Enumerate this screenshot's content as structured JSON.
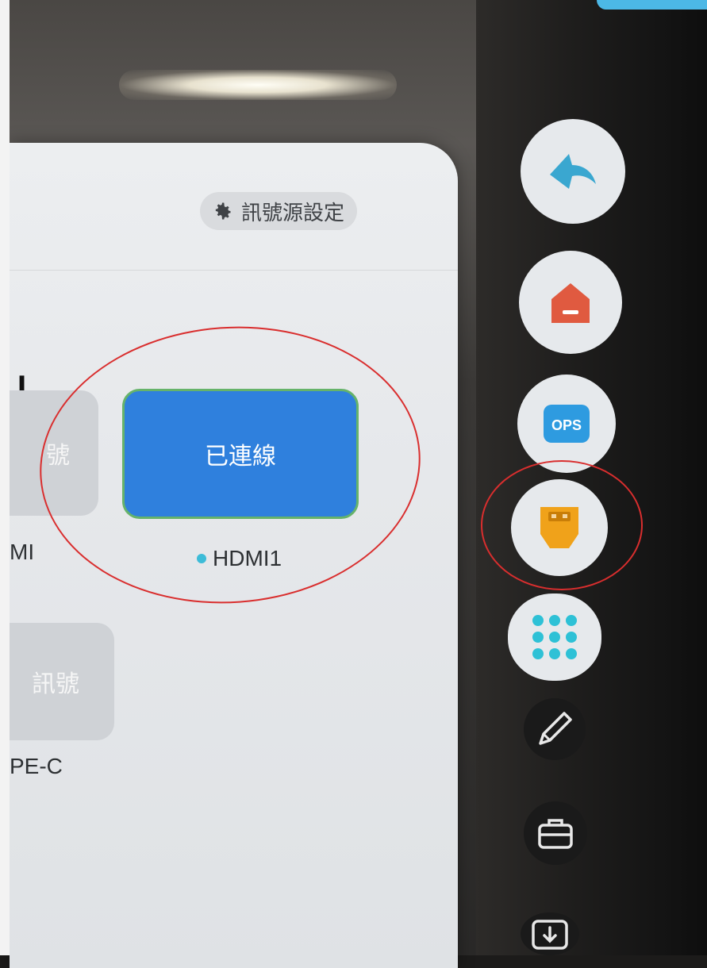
{
  "panel": {
    "settings_button_label": "訊號源設定",
    "bracket_char": "」",
    "sources": [
      {
        "tile_text": "號",
        "name": "MI"
      },
      {
        "tile_text": "已連線",
        "name": "HDMI1",
        "status": "connected"
      },
      {
        "tile_text": "訊號",
        "name": "PE-C"
      }
    ]
  },
  "dock": {
    "items": [
      {
        "name": "back",
        "icon": "back-arrow-icon",
        "color": "#3aa7d0"
      },
      {
        "name": "home",
        "icon": "home-icon",
        "color": "#e05a40"
      },
      {
        "name": "ops",
        "icon": "ops-icon",
        "label": "OPS",
        "color": "#2e9be0"
      },
      {
        "name": "input-source",
        "icon": "input-source-icon",
        "color": "#f0a21a"
      },
      {
        "name": "apps",
        "icon": "apps-grid-icon",
        "color": "#2ec1d6"
      },
      {
        "name": "pen",
        "icon": "pen-icon"
      },
      {
        "name": "toolbox",
        "icon": "toolbox-icon"
      },
      {
        "name": "save",
        "icon": "save-icon"
      }
    ]
  },
  "colors": {
    "connected_tile": "#2f80dd",
    "connected_border": "#66b36a",
    "annotation": "#d92e2e",
    "status_dot": "#3dbcd8"
  }
}
